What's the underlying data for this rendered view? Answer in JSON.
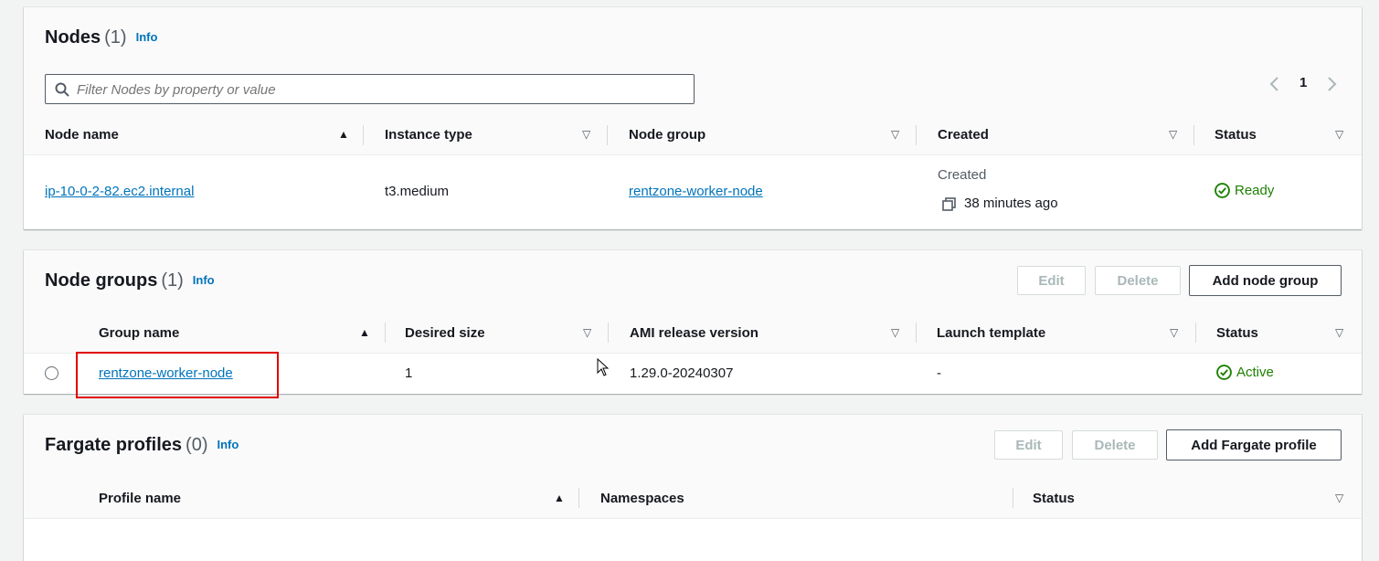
{
  "nodes": {
    "title": "Nodes",
    "count": "(1)",
    "info": "Info",
    "search_placeholder": "Filter Nodes by property or value",
    "page": "1",
    "columns": [
      "Node name",
      "Instance type",
      "Node group",
      "Created",
      "Status"
    ],
    "row": {
      "node_name": "ip-10-0-2-82.ec2.internal",
      "instance_type": "t3.medium",
      "node_group": "rentzone-worker-node",
      "created_label": "Created",
      "created_value": "38 minutes ago",
      "status": "Ready"
    }
  },
  "node_groups": {
    "title": "Node groups",
    "count": "(1)",
    "info": "Info",
    "edit": "Edit",
    "delete": "Delete",
    "add": "Add node group",
    "columns": [
      "Group name",
      "Desired size",
      "AMI release version",
      "Launch template",
      "Status"
    ],
    "row": {
      "group_name": "rentzone-worker-node",
      "desired_size": "1",
      "ami_release": "1.29.0-20240307",
      "launch_template": "-",
      "status": "Active"
    }
  },
  "fargate": {
    "title": "Fargate profiles",
    "count": "(0)",
    "info": "Info",
    "edit": "Edit",
    "delete": "Delete",
    "add": "Add Fargate profile",
    "columns": [
      "Profile name",
      "Namespaces",
      "Status"
    ]
  },
  "colors": {
    "link": "#0073bb",
    "success": "#1d8102",
    "highlight": "#e00000"
  }
}
